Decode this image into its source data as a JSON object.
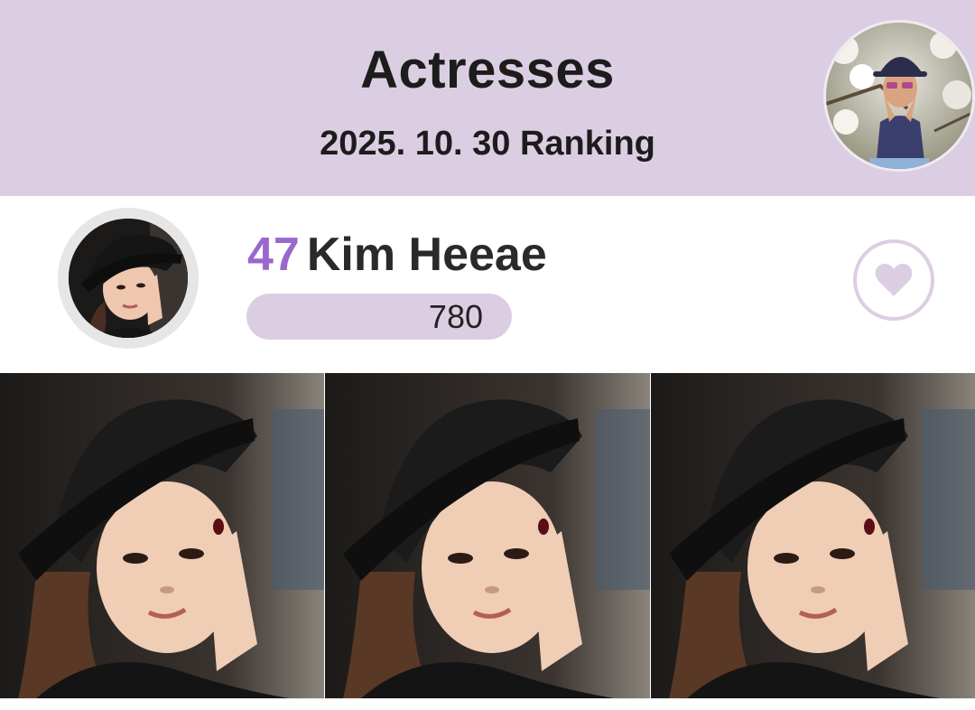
{
  "header": {
    "title": "Actresses",
    "subtitle": "2025. 10. 30 Ranking"
  },
  "entry": {
    "rank": "47",
    "name": "Kim Heeae",
    "votes": "780"
  },
  "colors": {
    "header_bg": "#dccee2",
    "rank_accent": "#9a68cc",
    "heart": "#dccee2"
  },
  "icons": {
    "like": "heart-icon"
  },
  "gallery": {
    "photo_count": 3
  }
}
